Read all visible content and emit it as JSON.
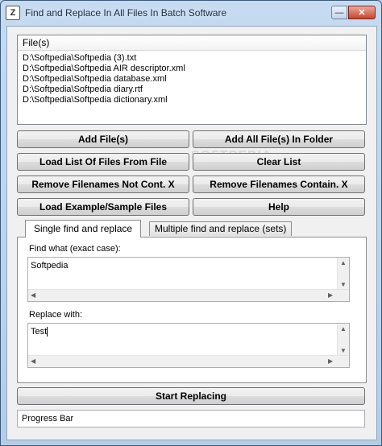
{
  "window": {
    "title": "Find and Replace In All Files In Batch Software"
  },
  "file_list": {
    "header": "File(s)",
    "items": [
      "D:\\Softpedia\\Softpedia (3).txt",
      "D:\\Softpedia\\Softpedia AIR descriptor.xml",
      "D:\\Softpedia\\Softpedia database.xml",
      "D:\\Softpedia\\Softpedia diary.rtf",
      "D:\\Softpedia\\Softpedia dictionary.xml"
    ]
  },
  "buttons": {
    "add_files": "Add File(s)",
    "add_folder": "Add All File(s) In Folder",
    "load_list": "Load List Of Files From File",
    "clear_list": "Clear List",
    "remove_not_cont": "Remove Filenames Not Cont. X",
    "remove_contain": "Remove Filenames Contain. X",
    "load_example": "Load Example/Sample Files",
    "help": "Help",
    "start": "Start Replacing"
  },
  "tabs": {
    "single": "Single find and replace",
    "multiple": "Multiple find and replace (sets)"
  },
  "find": {
    "label": "Find what (exact case):",
    "value": "Softpedia"
  },
  "replace": {
    "label": "Replace with:",
    "value": "Test"
  },
  "status": {
    "progress_label": "Progress Bar"
  },
  "colors": {
    "frame": "#b9d1ea",
    "client": "#f0f0f0",
    "close": "#c8452e"
  }
}
